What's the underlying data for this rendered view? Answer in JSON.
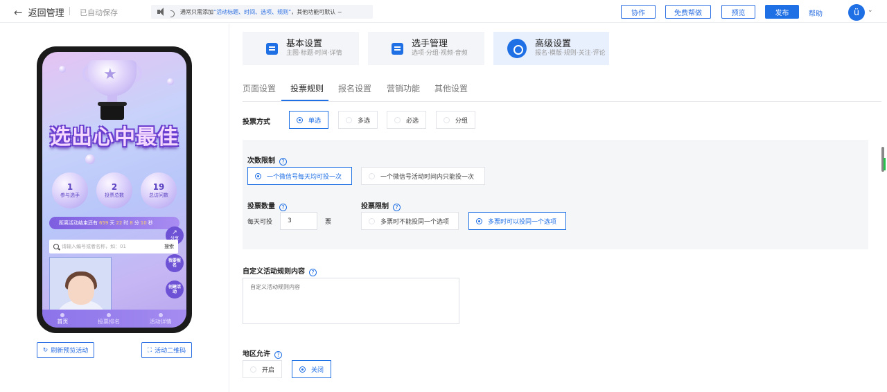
{
  "header": {
    "back_label": "返回管理",
    "autosave": "已自动保存",
    "notice_prefix": "通常只需添加",
    "notice_highlight": "“活动标题、时间、选项、规则”",
    "notice_suffix": "，其他功能可默认 ~",
    "buttons": {
      "collab": "协作",
      "free_help": "免费帮做",
      "preview": "预览",
      "publish": "发布"
    },
    "help": "帮助",
    "avatar_letter": "ü"
  },
  "preview": {
    "banner_title": "选出心中最佳",
    "stats": [
      {
        "num": "1",
        "label": "参与选手"
      },
      {
        "num": "2",
        "label": "投票总数"
      },
      {
        "num": "19",
        "label": "总访问数"
      }
    ],
    "countdown": {
      "prefix": "距离活动结束还有",
      "days": "659",
      "d_unit": "天",
      "hours": "22",
      "h_unit": "时",
      "minutes": "8",
      "m_unit": "分",
      "seconds": "10",
      "s_unit": "秒"
    },
    "share": "分享",
    "search_placeholder": "请输入编号或者名称，如：01",
    "search_button": "搜索",
    "signup_button": "我要报名",
    "create_button": "创建活动",
    "tabbar": [
      "首页",
      "投票排名",
      "活动详情"
    ],
    "refresh_button": "刷新预览活动",
    "qrcode_button": "活动二维码"
  },
  "steps": [
    {
      "title": "基本设置",
      "sub": "主图·标题·时间·详情"
    },
    {
      "title": "选手管理",
      "sub": "选项·分组·视频·音频"
    },
    {
      "title": "高级设置",
      "sub": "报名·模版·规则·关注·评论"
    }
  ],
  "subtabs": [
    "页面设置",
    "投票规则",
    "报名设置",
    "营销功能",
    "其他设置"
  ],
  "vote_method": {
    "label": "投票方式",
    "options": [
      "单选",
      "多选",
      "必选",
      "分组"
    ],
    "selected": "单选"
  },
  "count_limit": {
    "label": "次数限制",
    "options": [
      "一个微信号每天均可投一次",
      "一个微信号活动时间内只能投一次"
    ],
    "selected": "一个微信号每天均可投一次"
  },
  "vote_count": {
    "label": "投票数量",
    "prefix": "每天可投",
    "value": "3",
    "unit": "票"
  },
  "vote_limit": {
    "label": "投票限制",
    "options": [
      "多票时不能投同一个选项",
      "多票时可以投同一个选项"
    ],
    "selected": "多票时可以投同一个选项"
  },
  "custom_rules": {
    "label": "自定义活动规则内容",
    "placeholder": "自定义活动规则内容"
  },
  "region": {
    "label": "地区允许",
    "options": [
      "开启",
      "关闭"
    ],
    "selected": "关闭"
  },
  "colors": {
    "accent": "#1f6fe5",
    "muted": "#999999"
  }
}
